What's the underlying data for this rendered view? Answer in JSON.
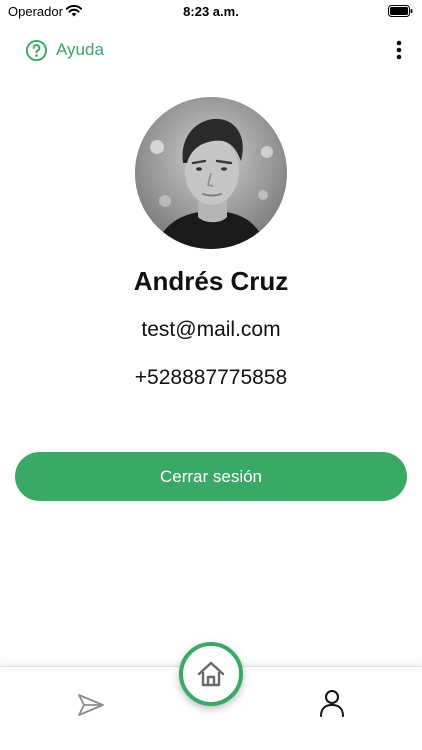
{
  "status_bar": {
    "carrier": "Operador",
    "time": "8:23 a.m.",
    "wifi_icon": "wifi-icon",
    "battery_icon": "battery-icon"
  },
  "top_bar": {
    "help_label": "Ayuda",
    "help_icon": "question-circle-icon",
    "menu_icon": "more-vertical-icon"
  },
  "profile": {
    "avatar_icon": "avatar-photo",
    "name": "Andrés Cruz",
    "email": "test@mail.com",
    "phone": "+528887775858"
  },
  "actions": {
    "logout_label": "Cerrar sesión"
  },
  "bottom_nav": {
    "items": [
      {
        "icon": "send-icon"
      },
      {
        "icon": "home-icon",
        "active": true
      },
      {
        "icon": "user-icon"
      }
    ]
  },
  "colors": {
    "accent": "#3aa866",
    "text": "#111111",
    "background": "#ffffff"
  }
}
